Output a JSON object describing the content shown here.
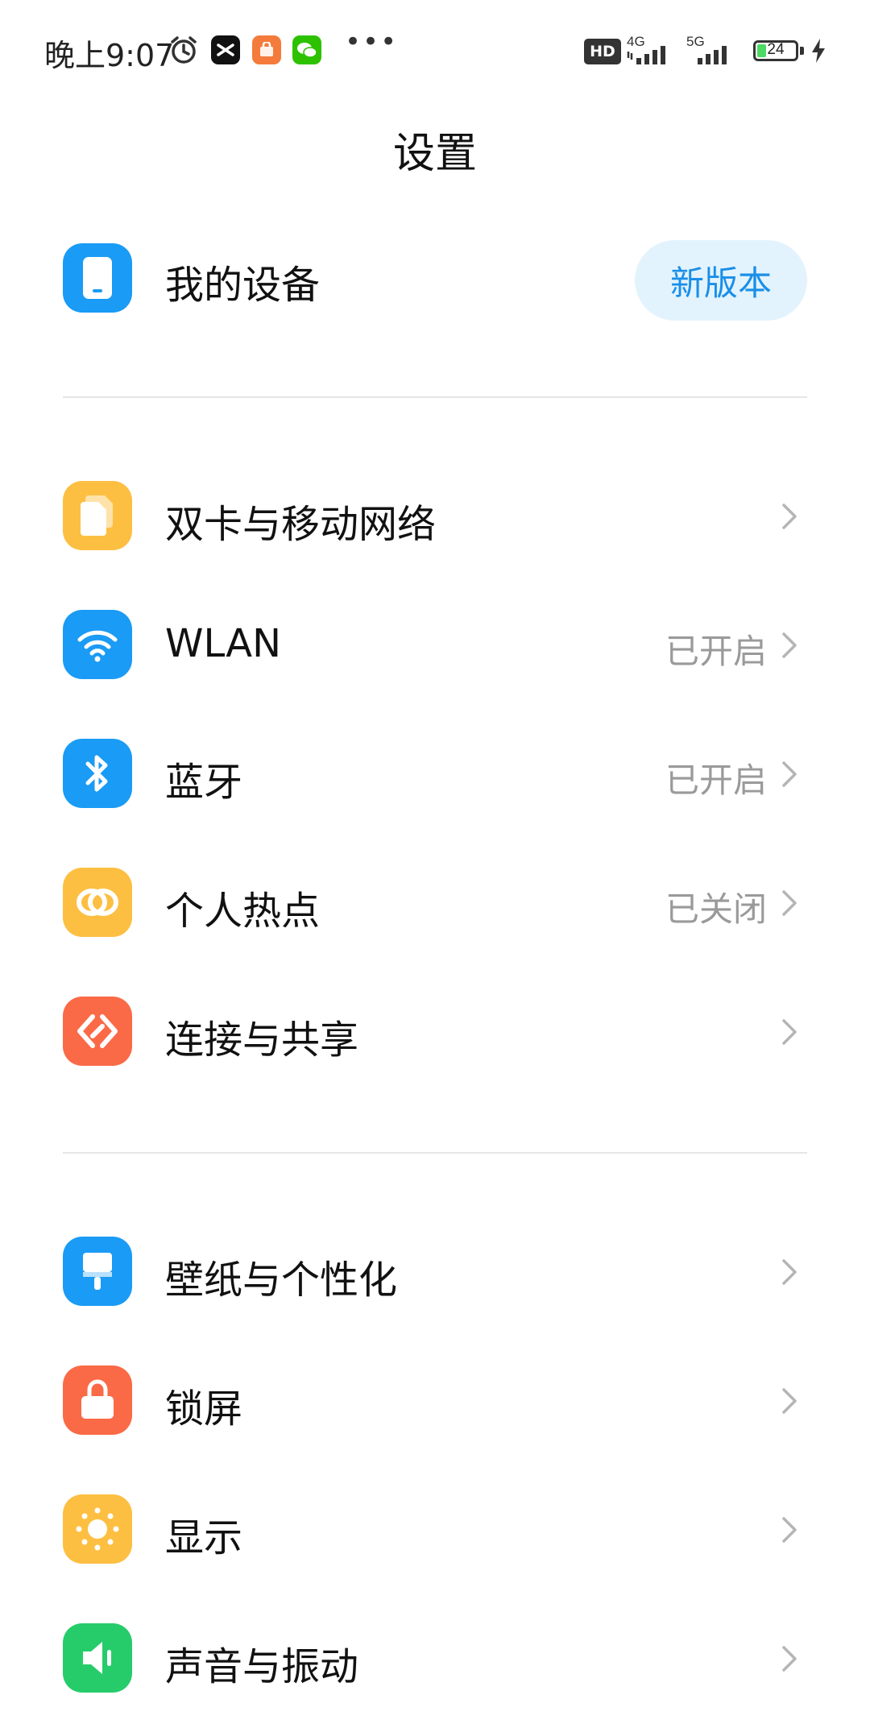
{
  "status_bar": {
    "time": "晚上9:07",
    "hd": "HD",
    "net_4g": "4G",
    "net_5g": "5G",
    "battery": "24",
    "battery_level": 0.24
  },
  "title": "设置",
  "device": {
    "label": "我的设备",
    "badge": "新版本"
  },
  "sections": [
    {
      "items": [
        {
          "label": "双卡与移动网络",
          "value": ""
        },
        {
          "label": "WLAN",
          "value": "已开启"
        },
        {
          "label": "蓝牙",
          "value": "已开启"
        },
        {
          "label": "个人热点",
          "value": "已关闭"
        },
        {
          "label": "连接与共享",
          "value": ""
        }
      ]
    },
    {
      "items": [
        {
          "label": "壁纸与个性化",
          "value": ""
        },
        {
          "label": "锁屏",
          "value": ""
        },
        {
          "label": "显示",
          "value": ""
        },
        {
          "label": "声音与振动",
          "value": ""
        }
      ]
    }
  ],
  "colors": {
    "blue": "#1a9bf5",
    "yellow": "#fdbf42",
    "orange": "#fa6a46",
    "green": "#27cc6a",
    "pill_bg": "#e3f3fd",
    "pill_text": "#1a8fe8"
  }
}
